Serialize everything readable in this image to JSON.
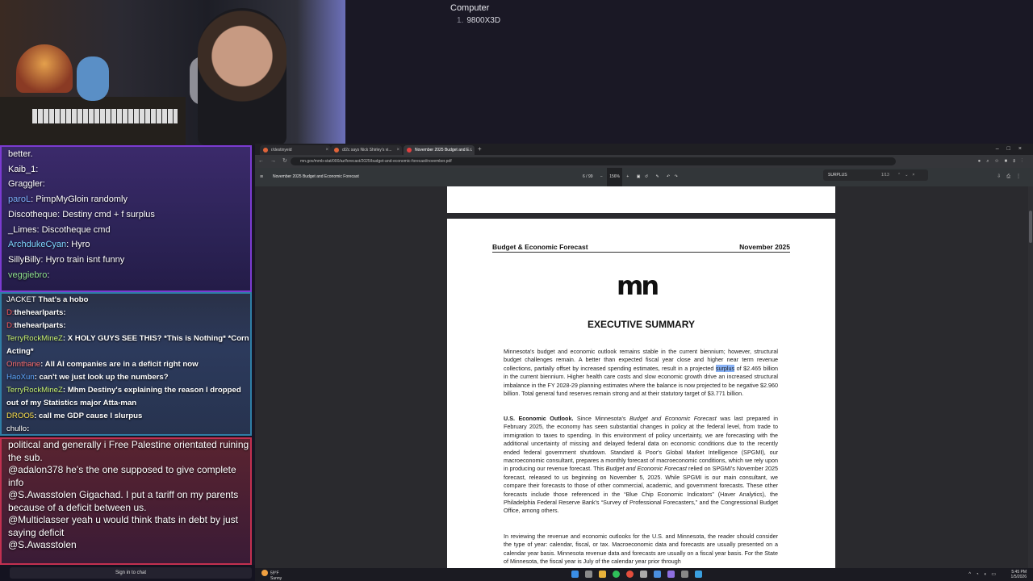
{
  "info": {
    "title": "Computer",
    "item_number": "1.",
    "item_value": "9800X3D"
  },
  "chat": {
    "panel1": [
      {
        "user": "",
        "text": "better.",
        "color": "#ffffff"
      },
      {
        "user": "Kaib_1",
        "text": ":",
        "color": "#ffffff"
      },
      {
        "user": "Graggler",
        "text": ":",
        "color": "#ffffff"
      },
      {
        "user": "paroL",
        "text": ": PimpMyGloin randomly",
        "color": "#7fb2ff"
      },
      {
        "user": "Discotheque",
        "text": ": Destiny cmd + f surplus",
        "color": "#ffffff"
      },
      {
        "user": "_Limes",
        "text": ": Discotheque cmd",
        "color": "#ffffff"
      },
      {
        "user": "ArchdukeCyan",
        "text": ": Hyro",
        "color": "#7fd6ff"
      },
      {
        "user": "SillyBilly",
        "text": ": Hyro train isnt funny",
        "color": "#ffffff"
      },
      {
        "user": "veggiebro",
        "text": ":",
        "color": "#8fe08f"
      }
    ],
    "panel2": [
      {
        "user": "JACKET",
        "text": " That's a hobo",
        "color": "#ffffff"
      },
      {
        "user": "D:",
        "text": "thehearlparts:",
        "color": "#ff5a5a"
      },
      {
        "user": "D:",
        "text": "thehearlparts:",
        "color": "#ff5a5a"
      },
      {
        "user": "TerryRockMineZ",
        "text": ": X HOLY GUYS SEE THIS? *This is Nothing* *Corn Acting*",
        "color": "#c7f070"
      },
      {
        "user": "Orinthane",
        "text": ": All AI companies are in a deficit right now",
        "color": "#ff6e6e"
      },
      {
        "user": "HaoXun",
        "text": ": can't we just look up the numbers?",
        "color": "#5fa8ff"
      },
      {
        "user": "TerryRockMineZ",
        "text": ": Mhm Destiny's explaining the reason I dropped out of my Statistics major  Atta-man",
        "color": "#c7f070"
      },
      {
        "user": "DROO5",
        "text": ": call me GDP cause I slurpus",
        "color": "#ffe34d"
      },
      {
        "user": "chullo",
        "text": ":",
        "color": "#ffffff"
      }
    ],
    "panel3": [
      {
        "user": "",
        "text": "political and generally i Free Palestine orientated ruining the sub.",
        "color": "#ffffff"
      },
      {
        "user": "@adalon378",
        "text": " he's the one supposed to give complete info",
        "color": "#ffffff"
      },
      {
        "user": "@S.Awasstolen",
        "text": " Gigachad. I put a tariff on my parents because of a deficit between us.",
        "color": "#ffffff"
      },
      {
        "user": "@Multiclasser",
        "text": " yeah u would think thats in debt by just saying deficit",
        "color": "#ffffff"
      },
      {
        "user": "@S.Awasstolen",
        "text": "",
        "color": "#ffffff"
      }
    ],
    "sign_in": "Sign in to chat"
  },
  "browser": {
    "tabs": [
      {
        "label": "r/destinyeid",
        "active": false,
        "color": "#e0643a"
      },
      {
        "label": "d/2c says Nick Shirley's vi...",
        "active": false,
        "color": "#e0643a"
      },
      {
        "label": "November 2025 Budget and E...",
        "active": true,
        "color": "#e04040"
      }
    ],
    "url": "mn.gov/mmb-stat/000/az/forecast/2025/budget-and-economic-forecast/november.pdf",
    "pdf": {
      "doc_title": "November 2025 Budget and Economic Forecast",
      "page_current": "6",
      "page_total": "/ 99",
      "zoom": "156%",
      "find_query": "SURPLUS",
      "find_count": "1/13"
    }
  },
  "document": {
    "header_left": "Budget & Economic Forecast",
    "header_right": "November 2025",
    "logo": "mn",
    "section_title": "EXECUTIVE SUMMARY",
    "p1_a": "Minnesota's budget and economic outlook remains stable in the current biennium; however, structural budget challenges remain.  A better than expected fiscal year close and higher near term revenue collections, partially offset by increased spending estimates, result in a projected ",
    "p1_hl": "surplus",
    "p1_b": " of $2.465 billion in the current biennium. Higher health care costs and slow economic growth drive an increased structural imbalance in the FY 2028-29 planning estimates where the balance is now projected to be negative $2.960 billion.  Total general fund reserves remain strong and at their statutory target of $3.771 billion.",
    "p2_bold": "U.S. Economic Outlook.",
    "p2_a": " Since Minnesota's ",
    "p2_i1": "Budget and Economic Forecast",
    "p2_b": " was last prepared in February 2025, the economy has seen substantial changes in policy at the federal level, from trade to immigration to taxes to spending. In this environment of policy uncertainty, we are forecasting with the additional uncertainty of missing and delayed federal data on economic conditions due to the recently ended federal government shutdown. Standard & Poor's Global Market Intelligence (SPGMI), our macroeconomic consultant, prepares a monthly forecast of macroeconomic conditions, which we rely upon in producing our revenue forecast. This ",
    "p2_i2": "Budget and Economic Forecast",
    "p2_c": " relied on SPGMI's November 2025 forecast, released to us beginning on November 5, 2025. While SPGMI is our main consultant, we compare their forecasts to those of other commercial, academic, and government forecasts. These other forecasts include those referenced in the “Blue Chip Economic Indicators” (Haver Analytics), the Philadelphia Federal Reserve Bank's “Survey of Professional Forecasters,” and the Congressional Budget Office, among others.",
    "p3": "In reviewing the revenue and economic outlooks for the U.S. and Minnesota, the reader should consider the type of year: calendar, fiscal, or tax. Macroeconomic data and forecasts are usually presented on a calendar year basis. Minnesota revenue data and forecasts are usually on a fiscal year basis. For the State of Minnesota, the fiscal year is July of the calendar year prior through"
  },
  "taskbar": {
    "temp": "59°F",
    "condition": "Sunny",
    "time": "5:45 PM",
    "date": "1/5/2026"
  }
}
